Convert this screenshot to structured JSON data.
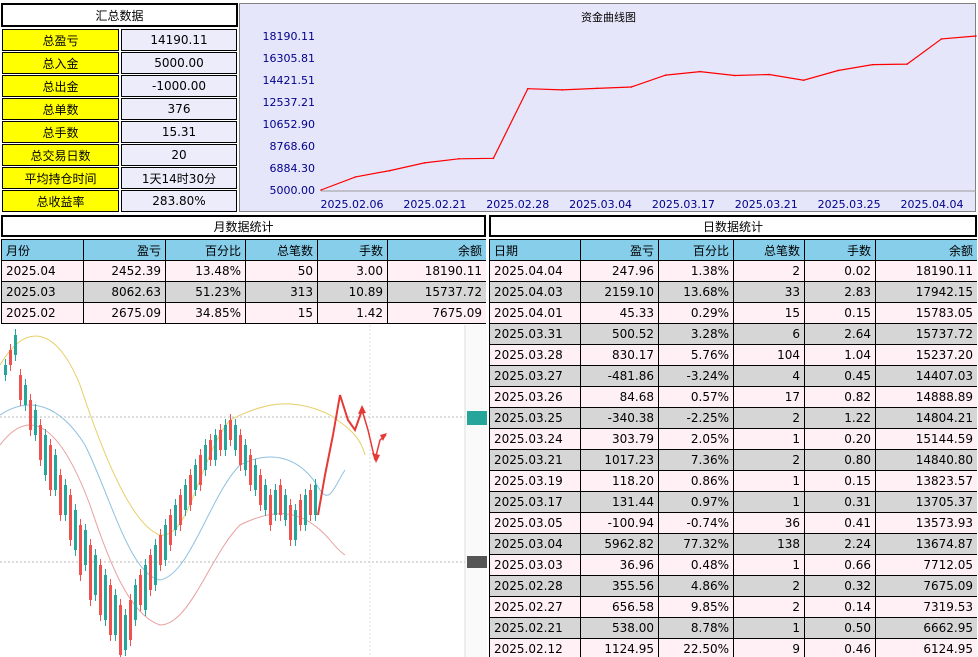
{
  "summary": {
    "title": "汇总数据",
    "rows": [
      {
        "label": "总盈亏",
        "value": "14190.11"
      },
      {
        "label": "总入金",
        "value": "5000.00"
      },
      {
        "label": "总出金",
        "value": "-1000.00"
      },
      {
        "label": "总单数",
        "value": "376"
      },
      {
        "label": "总手数",
        "value": "15.31"
      },
      {
        "label": "总交易日数",
        "value": "20"
      },
      {
        "label": "平均持仓时间",
        "value": "1天14时30分"
      },
      {
        "label": "总收益率",
        "value": "283.80%"
      }
    ]
  },
  "chart_data": {
    "type": "line",
    "title": "资金曲线图",
    "y_ticks": [
      "18190.11",
      "16305.81",
      "14421.51",
      "12537.21",
      "10652.90",
      "8768.60",
      "6884.30",
      "5000.00"
    ],
    "ylim": [
      5000.0,
      18190.11
    ],
    "x_ticks": [
      "2025.02.06",
      "2025.02.21",
      "2025.02.28",
      "2025.03.04",
      "2025.03.17",
      "2025.03.21",
      "2025.03.25",
      "2025.04.04"
    ],
    "series": [
      {
        "values": [
          5000.0,
          6124.95,
          6662.95,
          7319.53,
          7675.09,
          7712.05,
          13674.87,
          13573.93,
          13705.37,
          13823.57,
          14840.8,
          15144.59,
          14804.21,
          14888.89,
          14407.03,
          15237.2,
          15737.72,
          15783.05,
          17942.15,
          18190.11
        ]
      }
    ],
    "line_color": "#ff0000"
  },
  "monthly": {
    "title": "月数据统计",
    "headers": [
      "月份",
      "盈亏",
      "百分比",
      "总笔数",
      "手数",
      "余额"
    ],
    "rows": [
      [
        "2025.04",
        "2452.39",
        "13.48%",
        "50",
        "3.00",
        "18190.11"
      ],
      [
        "2025.03",
        "8062.63",
        "51.23%",
        "313",
        "10.89",
        "15737.72"
      ],
      [
        "2025.02",
        "2675.09",
        "34.85%",
        "15",
        "1.42",
        "7675.09"
      ]
    ]
  },
  "daily": {
    "title": "日数据统计",
    "headers": [
      "日期",
      "盈亏",
      "百分比",
      "总笔数",
      "手数",
      "余额"
    ],
    "rows": [
      [
        "2025.04.04",
        "247.96",
        "1.38%",
        "2",
        "0.02",
        "18190.11"
      ],
      [
        "2025.04.03",
        "2159.10",
        "13.68%",
        "33",
        "2.83",
        "17942.15"
      ],
      [
        "2025.04.01",
        "45.33",
        "0.29%",
        "15",
        "0.15",
        "15783.05"
      ],
      [
        "2025.03.31",
        "500.52",
        "3.28%",
        "6",
        "2.64",
        "15737.72"
      ],
      [
        "2025.03.28",
        "830.17",
        "5.76%",
        "104",
        "1.04",
        "15237.20"
      ],
      [
        "2025.03.27",
        "-481.86",
        "-3.24%",
        "4",
        "0.45",
        "14407.03"
      ],
      [
        "2025.03.26",
        "84.68",
        "0.57%",
        "17",
        "0.82",
        "14888.89"
      ],
      [
        "2025.03.25",
        "-340.38",
        "-2.25%",
        "2",
        "1.22",
        "14804.21"
      ],
      [
        "2025.03.24",
        "303.79",
        "2.05%",
        "1",
        "0.20",
        "15144.59"
      ],
      [
        "2025.03.21",
        "1017.23",
        "7.36%",
        "2",
        "0.80",
        "14840.80"
      ],
      [
        "2025.03.19",
        "118.20",
        "0.86%",
        "1",
        "0.15",
        "13823.57"
      ],
      [
        "2025.03.17",
        "131.44",
        "0.97%",
        "1",
        "0.31",
        "13705.37"
      ],
      [
        "2025.03.05",
        "-100.94",
        "-0.74%",
        "36",
        "0.41",
        "13573.93"
      ],
      [
        "2025.03.04",
        "5962.82",
        "77.32%",
        "138",
        "2.24",
        "13674.87"
      ],
      [
        "2025.03.03",
        "36.96",
        "0.48%",
        "1",
        "0.66",
        "7712.05"
      ],
      [
        "2025.02.28",
        "355.56",
        "4.86%",
        "2",
        "0.32",
        "7675.09"
      ],
      [
        "2025.02.27",
        "656.58",
        "9.85%",
        "2",
        "0.14",
        "7319.53"
      ],
      [
        "2025.02.21",
        "538.00",
        "8.78%",
        "1",
        "0.50",
        "6662.95"
      ],
      [
        "2025.02.12",
        "1124.95",
        "22.50%",
        "9",
        "0.46",
        "6124.95"
      ]
    ]
  },
  "colors": {
    "label_bg": "#ffff00",
    "value_bg": "#ececfa",
    "header_bg": "#87ceeb",
    "row_odd": "#fff0f5",
    "row_even": "#d6d6d6",
    "chart_bg": "#e6e6fa",
    "axis_text": "#00008b"
  }
}
